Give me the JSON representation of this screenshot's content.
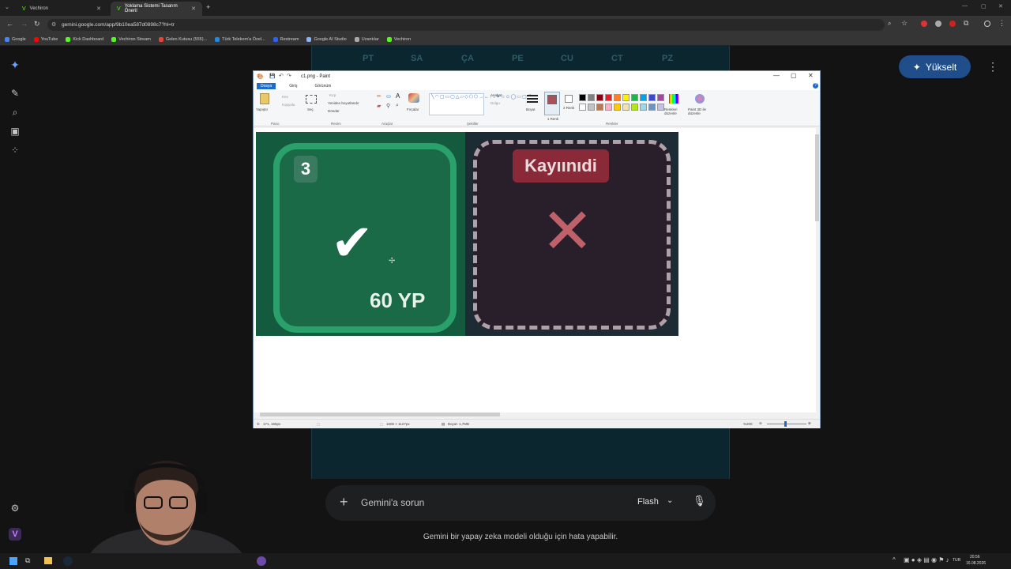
{
  "browser": {
    "tabs": [
      {
        "title": "Vechiron",
        "active": false
      },
      {
        "title": "Yoklama Sistemi Tasarım Öneril",
        "active": true
      }
    ],
    "url": "gemini.google.com/app/9b10ea587d0898c7?hl=tr",
    "bookmarks": [
      "Google",
      "YouTube",
      "Kick Dashboard",
      "Vechiron Stream",
      "Gelen Kutusu (555)...",
      "Türk Telekom'a Özel...",
      "Restream",
      "Google AI Studio",
      "Uzantılar",
      "Vechiron"
    ],
    "bookmark_colors": [
      "#4285f4",
      "#ff0000",
      "#53fc18",
      "#53fc18",
      "#ea4335",
      "#1e88e5",
      "#2962ff",
      "#8ab4f8",
      "#aaaaaa",
      "#53fc18"
    ]
  },
  "calendar": {
    "days": [
      "PT",
      "SA",
      "ÇA",
      "PE",
      "CU",
      "CT",
      "PZ"
    ]
  },
  "gemini": {
    "upgrade_label": "Yükselt",
    "prompt_placeholder": "Gemini'a sorun",
    "model_label": "Flash",
    "disclaimer": "Gemini bir yapay zeka modeli olduğu için hata yapabilir."
  },
  "paint": {
    "title": "c1.png - Paint",
    "ribbon_tabs": [
      "Dosya",
      "Giriş",
      "Görünüm"
    ],
    "groups": [
      "Pano",
      "Resim",
      "Araçlar",
      "Şekiller",
      "Renkler"
    ],
    "tool_labels": {
      "paste": "Yapıştır",
      "cut": "Kes",
      "copy": "Kopyala",
      "select": "Seç",
      "crop": "Kırp",
      "resize": "Yeniden boyutlandır",
      "rotate": "Döndür",
      "brushes": "Fırçalar",
      "outline": "Anahat",
      "fill": "Dolgu",
      "size": "Boyut",
      "color1": "1 Renk",
      "color2": "2 Renk",
      "edit_colors": "Renkleri düzenle",
      "paint3d": "Paint 3D ile düzenle"
    },
    "palette": [
      "#000000",
      "#7f7f7f",
      "#880015",
      "#ed1c24",
      "#ff7f27",
      "#fff200",
      "#22b14c",
      "#00a2e8",
      "#3f48cc",
      "#a349a4",
      "#ffffff",
      "#c3c3c3",
      "#b97a57",
      "#ffaec9",
      "#ffc90e",
      "#efe4b0",
      "#b5e61d",
      "#99d9ea",
      "#7092be",
      "#c8bfe7"
    ],
    "status": {
      "cursor": "171, 165px",
      "dimensions": "1606 × 1127px",
      "size": "Boyut: 1,7MB",
      "zoom": "%200"
    },
    "image": {
      "left_card_number": "3",
      "left_card_points": "60 YP",
      "right_card_label": "Kayıınıdi"
    }
  },
  "taskbar": {
    "lang": "TUR",
    "time": "20:56",
    "date": "16.08.2026"
  }
}
